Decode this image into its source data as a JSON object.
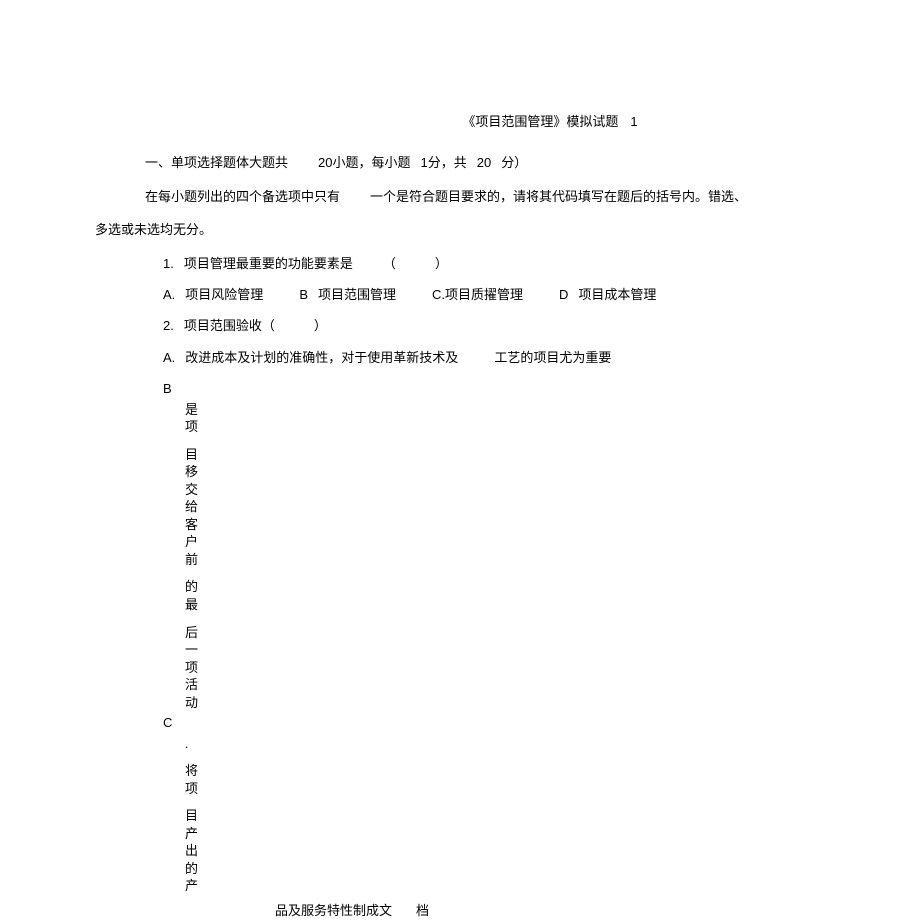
{
  "title": {
    "prefix": "《项目范围管理》模拟试题",
    "num": "1"
  },
  "section": {
    "label": "一、单项选择题体大题共",
    "count": "20",
    "unit": "小题，每小题",
    "points": "1",
    "perUnit": "分，共",
    "total": "20",
    "closing": "分）"
  },
  "instruction": {
    "part1": "在每小题列出的四个备选项中只有",
    "part2": "一个是符合题目要求的，请将其代码填写在题后的括号内。错选、",
    "part3": "多选或未选均无分。"
  },
  "q1": {
    "label": "1.",
    "text": "项目管理最重要的功能要素是",
    "paren": "（　　　）",
    "optA_letter": "A.",
    "optA": "项目风险管理",
    "optB_letter": "B",
    "optB": "项目范围管理",
    "optC_letter": "C.",
    "optC": "项目质擢管理",
    "optD_letter": "D",
    "optD": "项目成本管理"
  },
  "q2": {
    "label": "2.",
    "text": "项目范围验收（　　　）",
    "optA_letter": "A.",
    "optA_part1": "改进成本及计划的准确性，对于使用革新技术及",
    "optA_part2": "工艺的项目尤为重要",
    "optB_letter": "B",
    "optB_v1": "是项",
    "optB_v2": "目移交给客户前",
    "optB_v3": "的最",
    "optB_v4": "后一项活动",
    "optC_letter": "C",
    "optC_dot": ".",
    "optC_v1": "将项",
    "optC_v2": "目产出的产",
    "optC_footer_1": "品及服务特性制成文",
    "optC_footer_2": "档"
  }
}
